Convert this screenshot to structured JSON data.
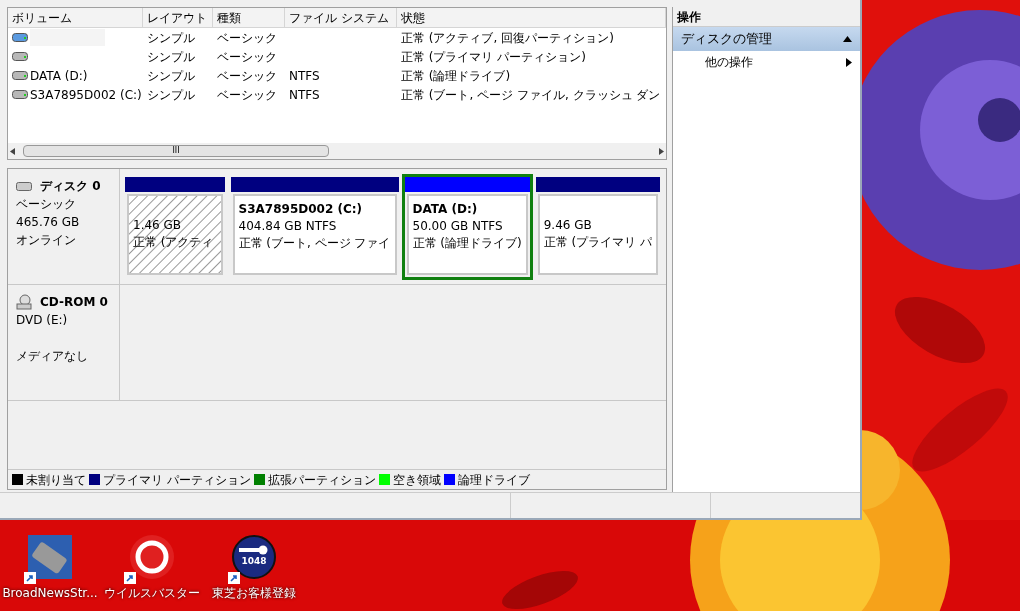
{
  "volume_table": {
    "columns": [
      "ボリューム",
      "レイアウト",
      "種類",
      "ファイル システム",
      "状態"
    ],
    "rows": [
      {
        "kind": "active",
        "cells": [
          "",
          "シンプル",
          "ベーシック",
          "",
          "正常 (アクティブ, 回復パーティション)"
        ]
      },
      {
        "kind": "basic",
        "cells": [
          "",
          "シンプル",
          "ベーシック",
          "",
          "正常 (プライマリ パーティション)"
        ]
      },
      {
        "kind": "basic",
        "cells": [
          "DATA (D:)",
          "シンプル",
          "ベーシック",
          "NTFS",
          "正常 (論理ドライブ)"
        ]
      },
      {
        "kind": "basic",
        "cells": [
          "S3A7895D002 (C:)",
          "シンプル",
          "ベーシック",
          "NTFS",
          "正常 (ブート, ページ ファイル, クラッシュ ダン"
        ]
      }
    ],
    "scroll_grip": "III"
  },
  "disks": [
    {
      "kind": "disk",
      "name": "ディスク 0",
      "lines": [
        "ベーシック",
        "465.76 GB",
        "オンライン"
      ],
      "partitions": [
        {
          "kind": "hatched",
          "color": "#000080",
          "selected": false,
          "lines": [
            "1.46 GB",
            "正常 (アクティ"
          ]
        },
        {
          "kind": "plain",
          "color": "#000080",
          "selected": false,
          "title": "S3A7895D002  (C:)",
          "lines": [
            "404.84 GB NTFS",
            "正常 (ブート, ページ ファイ"
          ]
        },
        {
          "kind": "plain",
          "color": "#0000ff",
          "selected": true,
          "title": "DATA  (D:)",
          "lines": [
            "50.00 GB NTFS",
            "正常 (論理ドライブ)"
          ]
        },
        {
          "kind": "plain",
          "color": "#000080",
          "selected": false,
          "lines": [
            "9.46 GB",
            "正常 (プライマリ パ"
          ]
        }
      ]
    },
    {
      "kind": "cdrom",
      "name": "CD-ROM 0",
      "lines": [
        "DVD (E:)"
      ],
      "status": "メディアなし"
    }
  ],
  "legend": [
    {
      "label": "未割り当て",
      "color": "#000000"
    },
    {
      "label": "プライマリ パーティション",
      "color": "#000080"
    },
    {
      "label": "拡張パーティション",
      "color": "#008000"
    },
    {
      "label": "空き領域",
      "color": "#00ff00"
    },
    {
      "label": "論理ドライブ",
      "color": "#0000ff"
    }
  ],
  "actions": {
    "title": "操作",
    "section": {
      "label": "ディスクの管理",
      "expanded": true
    },
    "items": [
      {
        "label": "他の操作"
      }
    ]
  },
  "desktop_icons": [
    {
      "kind": "news",
      "label": "BroadNewsStr..."
    },
    {
      "kind": "security",
      "label": "ウイルスバスター"
    },
    {
      "kind": "key",
      "label": "東芝お客様登録",
      "badge": "1048"
    }
  ]
}
